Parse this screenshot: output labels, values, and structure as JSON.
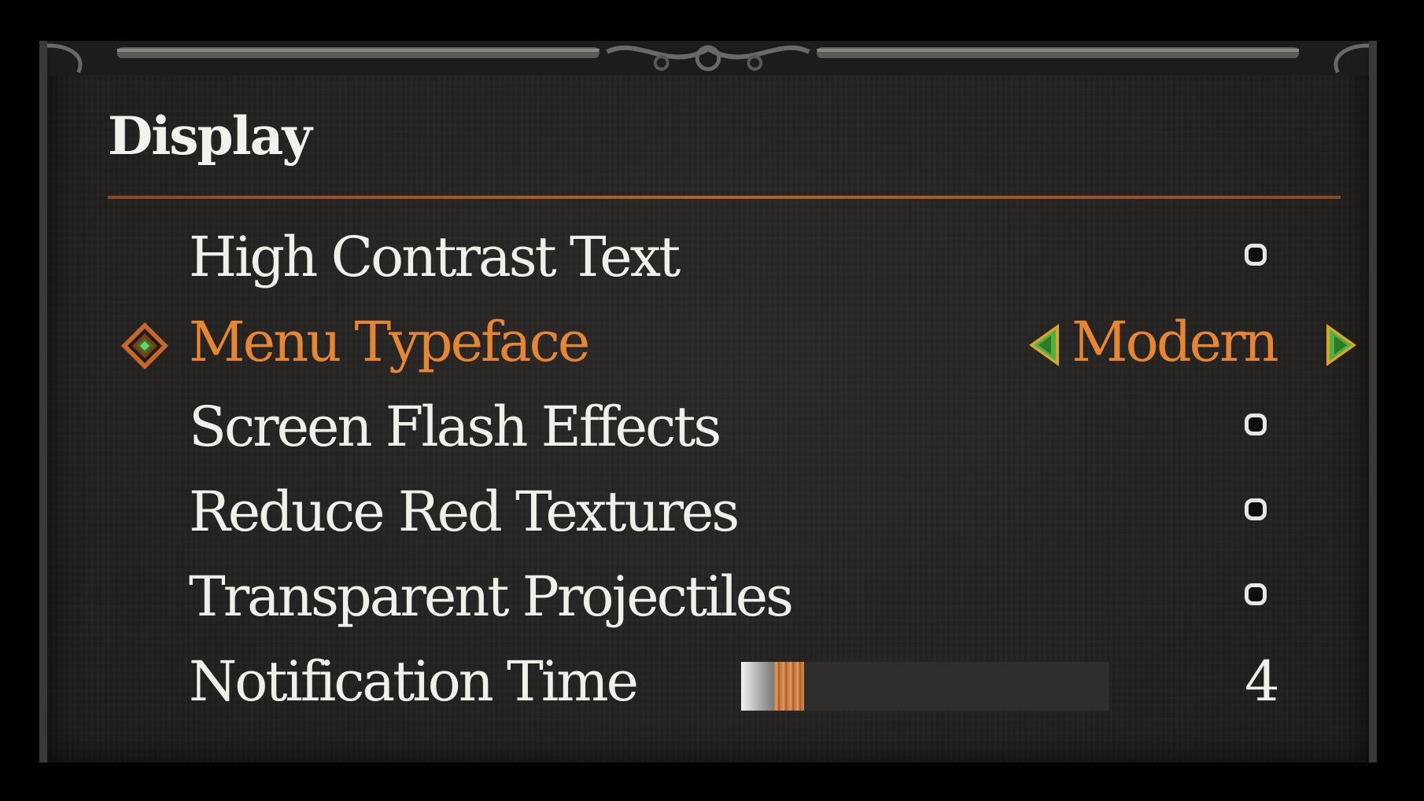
{
  "display_section": {
    "title": "Display",
    "options": [
      {
        "label": "High Contrast Text",
        "control": "toggle",
        "enabled": false
      },
      {
        "label": "Menu Typeface",
        "control": "selector",
        "value": "Modern",
        "selected": true
      },
      {
        "label": "Screen Flash Effects",
        "control": "toggle",
        "enabled": false
      },
      {
        "label": "Reduce Red Textures",
        "control": "toggle",
        "enabled": false
      },
      {
        "label": "Transparent Projectiles",
        "control": "toggle",
        "enabled": false
      },
      {
        "label": "Notification Time",
        "control": "slider",
        "value": "4",
        "fill_fraction": 0.17
      }
    ]
  },
  "colors": {
    "selected_text": "#e78632",
    "normal_text": "#f2efe8",
    "accent_rule": "#b5612c",
    "arrow_green": "#4fb043",
    "arrow_gold": "#d9a42c"
  },
  "icons": {
    "selection_marker": "diamond-selection-icon",
    "left_arrow": "arrow-left-icon",
    "right_arrow": "arrow-right-icon"
  }
}
